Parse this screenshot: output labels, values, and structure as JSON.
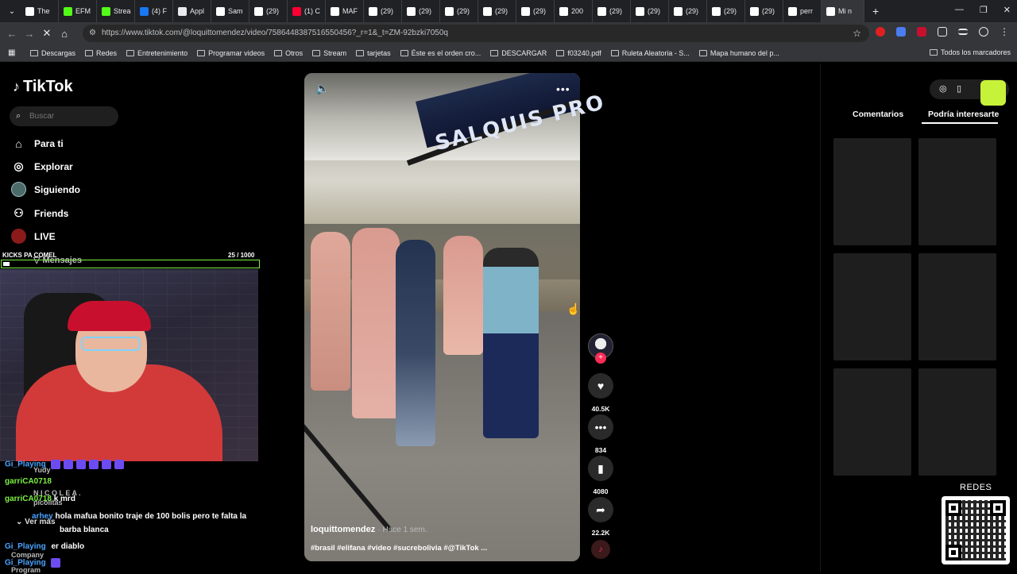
{
  "browser": {
    "tabs": [
      {
        "label": "The",
        "color": "#ffffff"
      },
      {
        "label": "EFM",
        "color": "#53fc18"
      },
      {
        "label": "Strea",
        "color": "#53fc18"
      },
      {
        "label": "(4) F",
        "color": "#1877f2"
      },
      {
        "label": "Appl",
        "color": "#e8eaed"
      },
      {
        "label": "Sam",
        "color": "#ffffff"
      },
      {
        "label": "(29)",
        "color": "#ffffff"
      },
      {
        "label": "(1) C",
        "color": "#ff0033"
      },
      {
        "label": "MAF",
        "color": "#ffffff"
      },
      {
        "label": "(29)",
        "color": "#ffffff"
      },
      {
        "label": "(29)",
        "color": "#ffffff"
      },
      {
        "label": "(29)",
        "color": "#ffffff"
      },
      {
        "label": "(29)",
        "color": "#ffffff"
      },
      {
        "label": "(29)",
        "color": "#ffffff"
      },
      {
        "label": "200",
        "color": "#ffffff"
      },
      {
        "label": "(29)",
        "color": "#ffffff"
      },
      {
        "label": "(29)",
        "color": "#ffffff"
      },
      {
        "label": "(29)",
        "color": "#ffffff"
      },
      {
        "label": "(29)",
        "color": "#ffffff"
      },
      {
        "label": "(29)",
        "color": "#ffffff"
      },
      {
        "label": "perr",
        "color": "#ffffff"
      },
      {
        "label": "Mi n",
        "color": "#ffffff"
      }
    ],
    "url": "https://www.tiktok.com/@loquittomendez/video/7586448387516550456?_r=1&_t=ZM-92bzki7050q",
    "bookmarks": [
      "Descargas",
      "Redes",
      "Entretenimiento",
      "Programar videos",
      "Otros",
      "Stream",
      "tarjetas",
      "Éste es el orden cro...",
      "DESCARGAR",
      "f03240.pdf",
      "Ruleta Aleatoria - S...",
      "Mapa humano del p..."
    ],
    "bookmarks_right": "Todos los marcadores"
  },
  "tiktok": {
    "logo": "TikTok",
    "search_placeholder": "Buscar",
    "nav": {
      "para_ti": "Para ti",
      "explorar": "Explorar",
      "siguiendo": "Siguiendo",
      "friends": "Friends",
      "live": "LIVE",
      "mensajes": "Mensajes"
    },
    "video": {
      "author": "loquittomendez",
      "time": "· Hace 1 sem.",
      "tags": "#brasil #elifana #video #sucrebolivia #@TikTok ...",
      "banner_text": "SALQUIS  PRO"
    },
    "actions": {
      "likes": "40.5K",
      "comments": "834",
      "saves": "4080",
      "shares": "22.2K"
    },
    "right_tabs": {
      "comments": "Comentarios",
      "interest": "Podría interesarte"
    }
  },
  "overlay": {
    "kicks_label": "KICKS PA COMEL",
    "kicks_count": "25 / 1000",
    "kicks_progress": 0.025,
    "chat": [
      {
        "name": "Gi_Playing",
        "text": ""
      },
      {
        "name": "Yudy",
        "text": ""
      },
      {
        "name": "garriCA0718",
        "text": ""
      },
      {
        "name": "N I C O L E A .",
        "text": ""
      },
      {
        "name": "picolitas",
        "text": ""
      },
      {
        "name": "garriCA0718",
        "text": "k mrd"
      },
      {
        "name": "arhey",
        "text": "hola mafua bonito traje de 100 bolis pero te falta la"
      },
      {
        "name": "",
        "text": "barba blanca"
      },
      {
        "name": "Gi_Playing",
        "text": "er diablo"
      },
      {
        "name": "Gi_Playing",
        "text": ""
      }
    ],
    "ver_mas": "Ver más",
    "company": "Company",
    "program": "Program",
    "redes": "REDES"
  }
}
